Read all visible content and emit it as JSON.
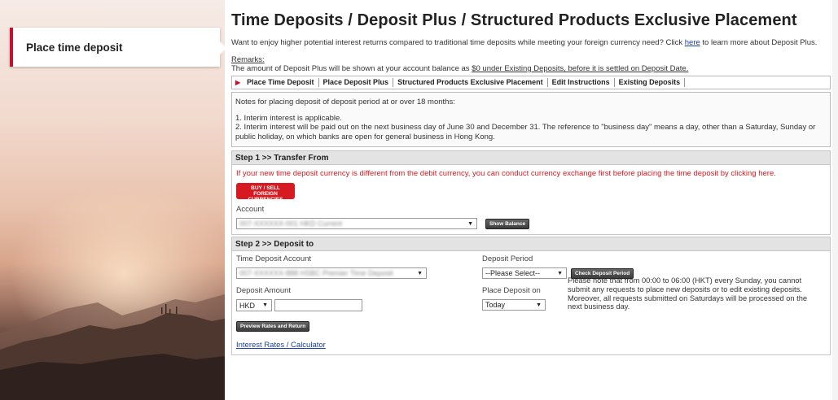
{
  "sidebar": {
    "active_item": "Place time deposit"
  },
  "page": {
    "title": "Time Deposits / Deposit Plus / Structured Products Exclusive Placement",
    "intro_before": "Want to enjoy higher potential interest returns compared to traditional time deposits while meeting your foreign currency need? Click ",
    "intro_link": "here",
    "intro_after": " to learn more about Deposit Plus.",
    "remarks_heading": "Remarks:",
    "remarks_before": "The amount of Deposit Plus will be shown at your account balance as ",
    "remarks_underlined": "$0 under Existing Deposits, before it is settled on Deposit Date."
  },
  "tabs": [
    {
      "label": "Place Time Deposit",
      "active": true
    },
    {
      "label": "Place Deposit Plus",
      "active": false
    },
    {
      "label": "Structured Products Exclusive Placement",
      "active": false
    },
    {
      "label": "Edit Instructions",
      "active": false
    },
    {
      "label": "Existing Deposits",
      "active": false
    }
  ],
  "notes": {
    "heading": "Notes for placing deposit of deposit period at or over 18 months:",
    "items": [
      "1. Interim interest is applicable.",
      "2. Interim interest will be paid out on the next business day of June 30 and December 31. The reference to \"business day\" means a day, other than a Saturday, Sunday or public holiday, on which banks are open for general business in Hong Kong."
    ]
  },
  "step1": {
    "title": "Step 1 >> Transfer From",
    "warning": "If your new time deposit currency is different from the debit currency, you can conduct currency exchange first before placing the time deposit by clicking here.",
    "buy_sell_line1": "BUY / SELL",
    "buy_sell_line2": "FOREIGN CURRENCIES",
    "account_label": "Account",
    "account_value": "007-XXXXXX-001 HKD Current",
    "show_balance_label": "Show Balance"
  },
  "step2": {
    "title": "Step 2 >> Deposit to",
    "td_account_label": "Time Deposit Account",
    "td_account_value": "007-XXXXXX-888 HSBC Premier Time Deposit",
    "deposit_period_label": "Deposit Period",
    "deposit_period_value": "--Please Select--",
    "check_period_label": "Check Deposit Period",
    "deposit_amount_label": "Deposit Amount",
    "currency_value": "HKD",
    "place_on_label": "Place Deposit on",
    "place_on_value": "Today",
    "notice": "Please note that from 00:00 to 06:00 (HKT) every Sunday, you cannot submit any requests to place new deposits or to edit existing deposits. Moreover, all requests submitted on Saturdays will be processed on the next business day.",
    "preview_label": "Preview Rates and Return",
    "rates_link": "Interest Rates / Calculator"
  },
  "colors": {
    "brand_red": "#c8102e",
    "link_blue": "#1a3fa0",
    "warning_red": "#d71921"
  }
}
